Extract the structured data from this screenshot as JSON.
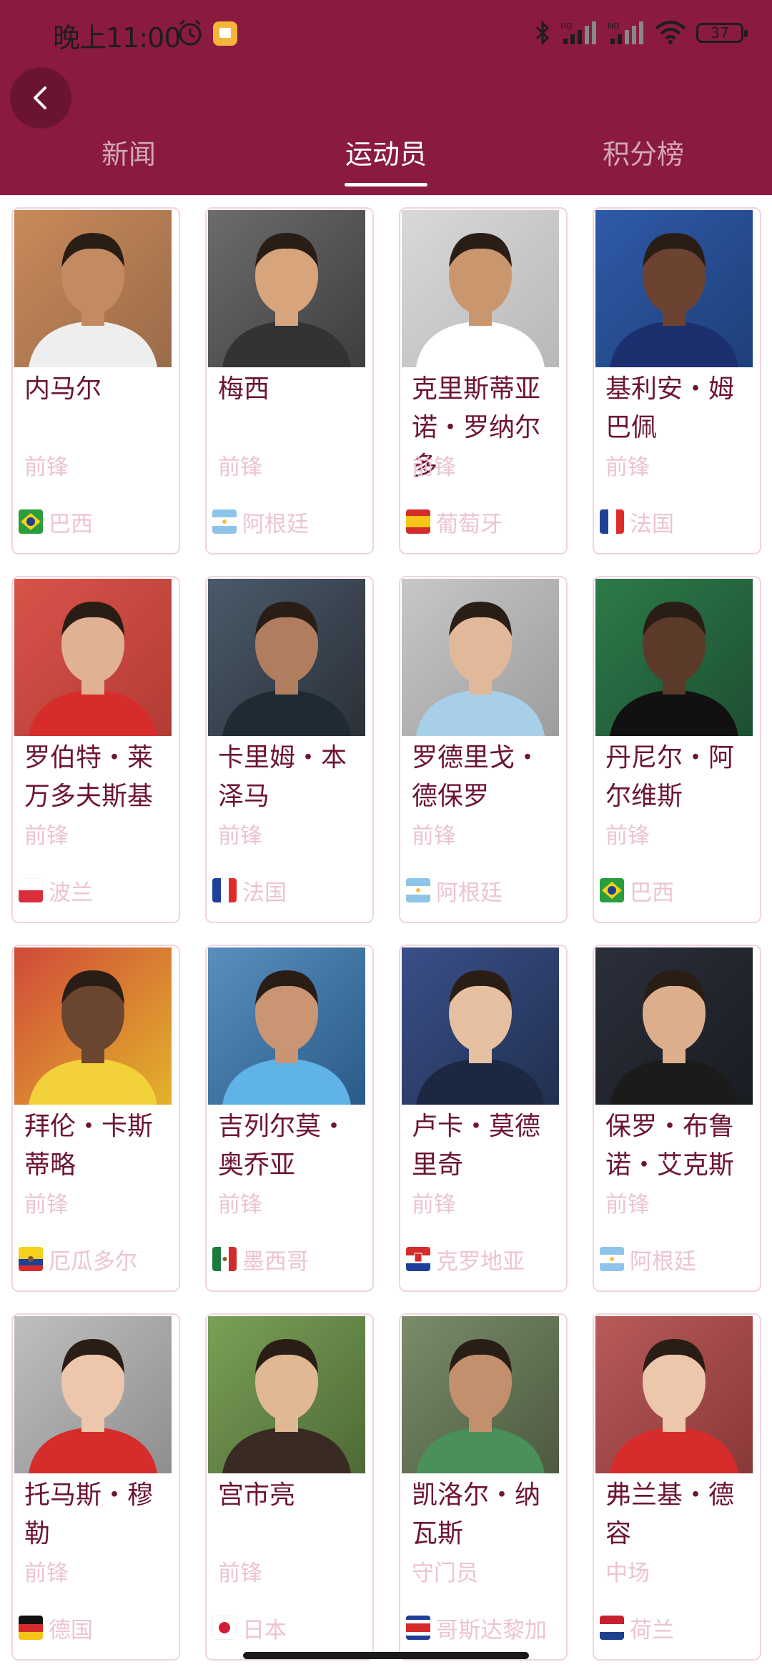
{
  "status_bar": {
    "time": "晚上11:00",
    "battery": "37",
    "network_labels": [
      "HD",
      "HD"
    ]
  },
  "tabs": [
    {
      "label": "新闻",
      "active": false
    },
    {
      "label": "运动员",
      "active": true
    },
    {
      "label": "积分榜",
      "active": false
    }
  ],
  "players": [
    {
      "name": "内马尔",
      "position": "前锋",
      "country": "巴西",
      "flag": "brazil"
    },
    {
      "name": "梅西",
      "position": "前锋",
      "country": "阿根廷",
      "flag": "argentina"
    },
    {
      "name": "克里斯蒂亚诺・罗纳尔多",
      "position": "前锋",
      "country": "葡萄牙",
      "flag": "spain-like"
    },
    {
      "name": "基利安・姆巴佩",
      "position": "前锋",
      "country": "法国",
      "flag": "france"
    },
    {
      "name": "罗伯特・莱万多夫斯基",
      "position": "前锋",
      "country": "波兰",
      "flag": "poland"
    },
    {
      "name": "卡里姆・本泽马",
      "position": "前锋",
      "country": "法国",
      "flag": "france"
    },
    {
      "name": "罗德里戈・德保罗",
      "position": "前锋",
      "country": "阿根廷",
      "flag": "argentina"
    },
    {
      "name": "丹尼尔・阿尔维斯",
      "position": "前锋",
      "country": "巴西",
      "flag": "brazil"
    },
    {
      "name": "拜伦・卡斯蒂略",
      "position": "前锋",
      "country": "厄瓜多尔",
      "flag": "ecuador"
    },
    {
      "name": "吉列尔莫・奥乔亚",
      "position": "前锋",
      "country": "墨西哥",
      "flag": "mexico"
    },
    {
      "name": "卢卡・莫德里奇",
      "position": "前锋",
      "country": "克罗地亚",
      "flag": "croatia"
    },
    {
      "name": "保罗・布鲁诺・艾克斯",
      "position": "前锋",
      "country": "阿根廷",
      "flag": "argentina"
    },
    {
      "name": "托马斯・穆勒",
      "position": "前锋",
      "country": "德国",
      "flag": "germany"
    },
    {
      "name": "宫市亮",
      "position": "前锋",
      "country": "日本",
      "flag": "japan"
    },
    {
      "name": "凯洛尔・纳瓦斯",
      "position": "守门员",
      "country": "哥斯达黎加",
      "flag": "costarica"
    },
    {
      "name": "弗兰基・德容",
      "position": "中场",
      "country": "荷兰",
      "flag": "netherlands"
    }
  ],
  "colors": {
    "header": "#8a1a40",
    "name_text": "#6d1436",
    "meta_text": "#ecc4d0",
    "card_border": "#f1d4dd"
  }
}
